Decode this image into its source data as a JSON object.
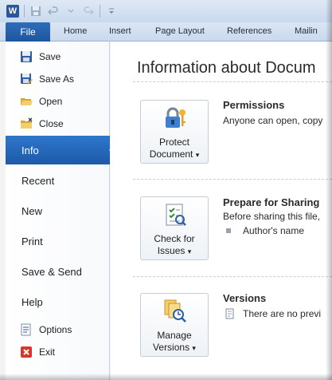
{
  "app": {
    "logo_letter": "W"
  },
  "ribbon": {
    "file_tab": "File",
    "tabs": [
      "Home",
      "Insert",
      "Page Layout",
      "References",
      "Mailin"
    ]
  },
  "backstage_nav": {
    "commands_top": [
      {
        "label": "Save",
        "icon": "save-icon"
      },
      {
        "label": "Save As",
        "icon": "save-as-icon"
      },
      {
        "label": "Open",
        "icon": "open-folder-icon"
      },
      {
        "label": "Close",
        "icon": "close-folder-icon"
      }
    ],
    "tabs": [
      "Info",
      "Recent",
      "New",
      "Print",
      "Save & Send",
      "Help"
    ],
    "active_tab": "Info",
    "commands_bottom": [
      {
        "label": "Options",
        "icon": "options-icon"
      },
      {
        "label": "Exit",
        "icon": "exit-icon"
      }
    ]
  },
  "main": {
    "title": "Information about Docum",
    "sections": [
      {
        "button_line1": "Protect",
        "button_line2": "Document",
        "title": "Permissions",
        "text": "Anyone can open, copy"
      },
      {
        "button_line1": "Check for",
        "button_line2": "Issues",
        "title": "Prepare for Sharing",
        "text": "Before sharing this file,",
        "bullet": "Author's name"
      },
      {
        "button_line1": "Manage",
        "button_line2": "Versions",
        "title": "Versions",
        "text": "There are no previ"
      }
    ],
    "dropdown_glyph": "▾"
  },
  "colors": {
    "accent": "#1d5aa8",
    "exit_red": "#d9362b"
  }
}
